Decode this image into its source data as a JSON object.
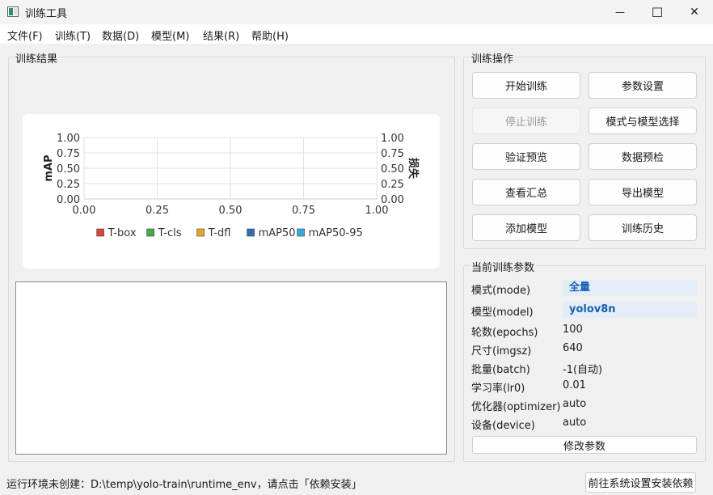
{
  "window": {
    "title": "训练工具",
    "minimize_symbol": "—",
    "maximize_symbol": "☐",
    "close_symbol": "✕"
  },
  "menu": [
    "文件(F)",
    "训练(T)",
    "数据(D)",
    "模型(M)",
    "结果(R)",
    "帮助(H)"
  ],
  "results_group": {
    "title": "训练结果"
  },
  "chart_data": {
    "type": "line",
    "x_ticks": [
      "0.00",
      "0.25",
      "0.50",
      "0.75",
      "1.00"
    ],
    "y_ticks": [
      "1.00",
      "0.75",
      "0.50",
      "0.25",
      "0.00"
    ],
    "y2_ticks": [
      "1.00",
      "0.75",
      "0.50",
      "0.25",
      "0.00"
    ],
    "xlim": [
      0,
      1
    ],
    "ylim": [
      0,
      1
    ],
    "y2lim": [
      0,
      1
    ],
    "ylabel": "mAP",
    "y2label": "损失",
    "grid": true,
    "legend_position": "bottom",
    "series": [
      {
        "name": "T-box",
        "color": "#d9453c",
        "values": []
      },
      {
        "name": "T-cls",
        "color": "#49a843",
        "values": []
      },
      {
        "name": "T-dfl",
        "color": "#f0a030",
        "values": []
      },
      {
        "name": "mAP50",
        "color": "#2f6db0",
        "values": []
      },
      {
        "name": "mAP50-95",
        "color": "#3aa7d6",
        "values": []
      }
    ]
  },
  "log": {
    "text": ""
  },
  "ops_group": {
    "title": "训练操作",
    "buttons": [
      {
        "label": "开始训练",
        "enabled": true
      },
      {
        "label": "参数设置",
        "enabled": true
      },
      {
        "label": "停止训练",
        "enabled": false
      },
      {
        "label": "模式与模型选择",
        "enabled": true
      },
      {
        "label": "验证预览",
        "enabled": true
      },
      {
        "label": "数据预检",
        "enabled": true
      },
      {
        "label": "查看汇总",
        "enabled": true
      },
      {
        "label": "导出模型",
        "enabled": true
      },
      {
        "label": "添加模型",
        "enabled": true
      },
      {
        "label": "训练历史",
        "enabled": true
      }
    ]
  },
  "params_group": {
    "title": "当前训练参数",
    "items": [
      {
        "label": "模式(mode)",
        "value": "全量"
      },
      {
        "label": "模型(model)",
        "value": "yolov8n"
      },
      {
        "label": "轮数(epochs)",
        "value": "100"
      },
      {
        "label": "尺寸(imgsz)",
        "value": "640"
      },
      {
        "label": "批量(batch)",
        "value": "-1(自动)"
      },
      {
        "label": "学习率(lr0)",
        "value": "0.01"
      },
      {
        "label": "优化器(optimizer)",
        "value": "auto"
      },
      {
        "label": "设备(device)",
        "value": "auto"
      }
    ],
    "modify_button": "修改参数",
    "highlight_color": "#e3edf8"
  },
  "status": {
    "text": "运行环境未创建：D:\\temp\\yolo-train\\runtime_env，请点击「依赖安装」",
    "button": "前往系统设置安装依赖"
  }
}
